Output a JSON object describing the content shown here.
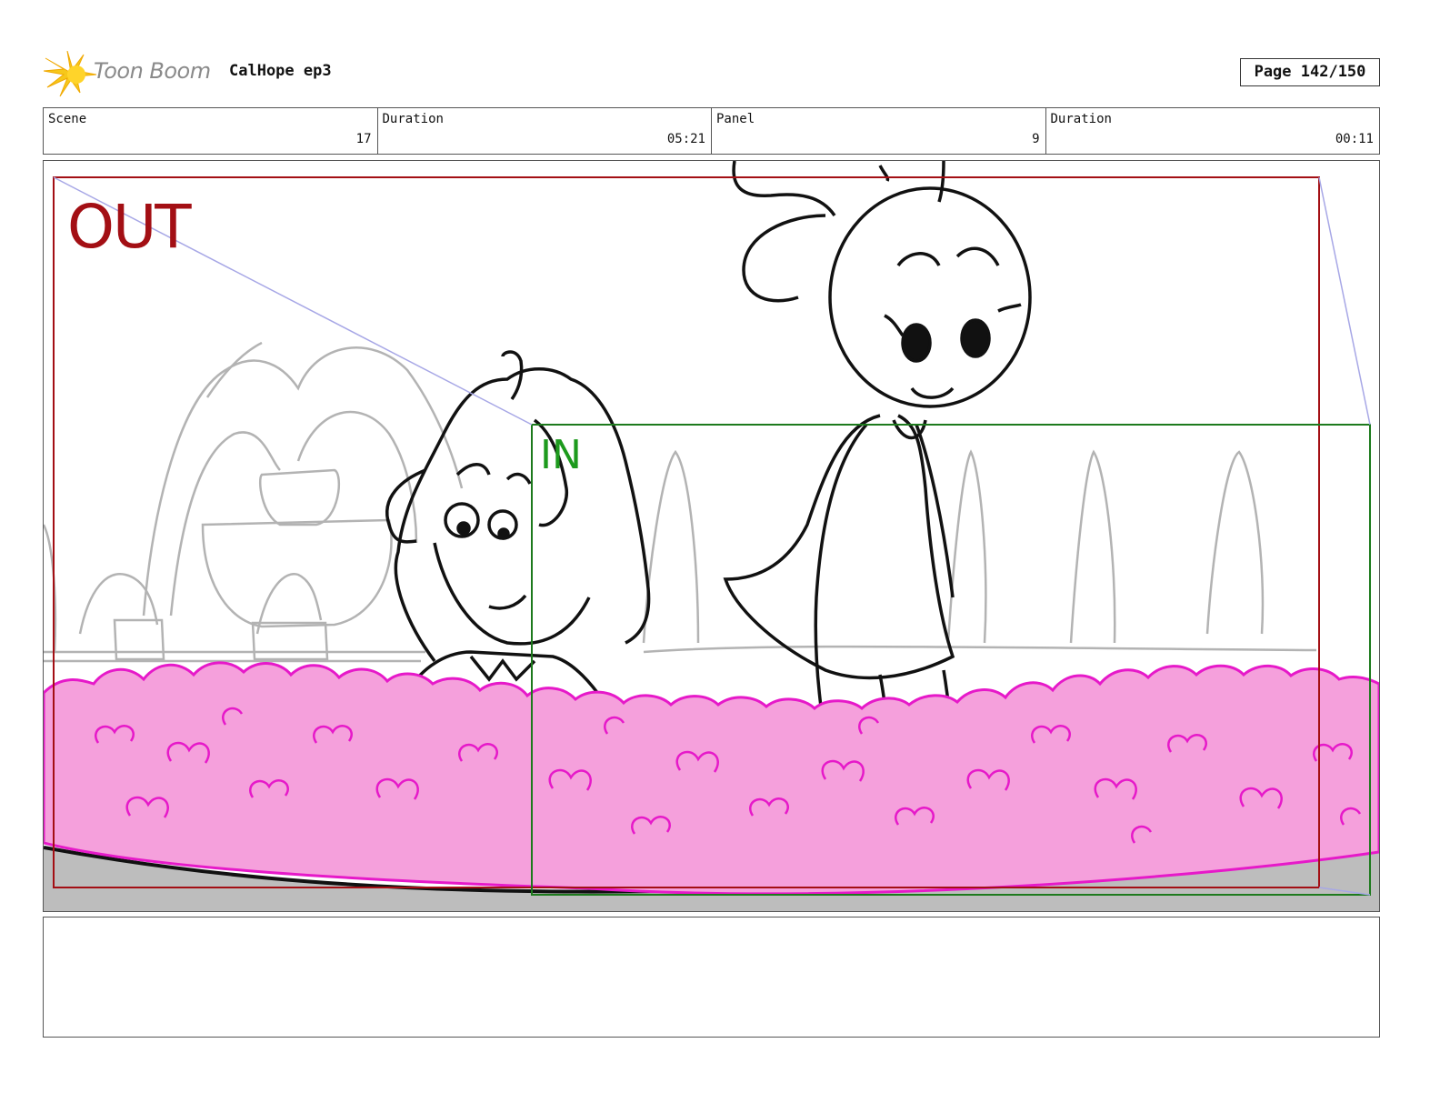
{
  "header": {
    "logo_text": "Toon Boom",
    "project_title": "CalHope ep3",
    "page_label": "Page 142/150"
  },
  "info": {
    "scene_label": "Scene",
    "scene_value": "17",
    "scene_duration_label": "Duration",
    "scene_duration_value": "05:21",
    "panel_label": "Panel",
    "panel_value": "9",
    "panel_duration_label": "Duration",
    "panel_duration_value": "00:11"
  },
  "panel": {
    "out_label": "OUT",
    "in_label": "IN",
    "colors": {
      "out_frame": "#a30f14",
      "in_frame": "#1d7a1d",
      "bush_fill": "#f5a0dc",
      "bush_stroke": "#e619c9",
      "background_sketch": "#b3b3b3",
      "ground": "#bdbdbd"
    }
  },
  "notes": {
    "text": ""
  }
}
